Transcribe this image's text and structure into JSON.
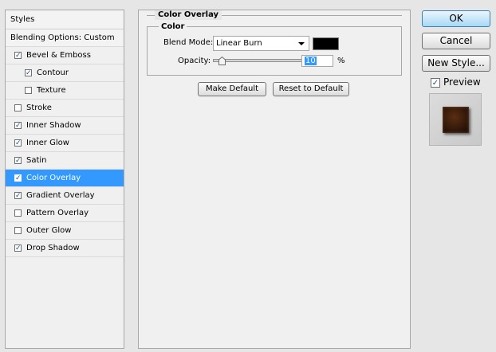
{
  "styles_panel": {
    "header": "Styles",
    "blending_options": "Blending Options: Custom",
    "items": [
      {
        "label": "Bevel & Emboss",
        "checked": true,
        "indent": false
      },
      {
        "label": "Contour",
        "checked": true,
        "indent": true
      },
      {
        "label": "Texture",
        "checked": false,
        "indent": true
      },
      {
        "label": "Stroke",
        "checked": false,
        "indent": false
      },
      {
        "label": "Inner Shadow",
        "checked": true,
        "indent": false
      },
      {
        "label": "Inner Glow",
        "checked": true,
        "indent": false
      },
      {
        "label": "Satin",
        "checked": true,
        "indent": false
      },
      {
        "label": "Color Overlay",
        "checked": true,
        "indent": false,
        "selected": true
      },
      {
        "label": "Gradient Overlay",
        "checked": true,
        "indent": false
      },
      {
        "label": "Pattern Overlay",
        "checked": false,
        "indent": false
      },
      {
        "label": "Outer Glow",
        "checked": false,
        "indent": false
      },
      {
        "label": "Drop Shadow",
        "checked": true,
        "indent": false
      }
    ]
  },
  "color_overlay": {
    "title": "Color Overlay",
    "group_title": "Color",
    "blend_mode_label": "Blend Mode:",
    "blend_mode_value": "Linear Burn",
    "overlay_color": "#000000",
    "opacity_label": "Opacity:",
    "opacity_value": "10",
    "opacity_unit": "%",
    "opacity_fraction": 0.1,
    "make_default_label": "Make Default",
    "reset_default_label": "Reset to Default"
  },
  "actions": {
    "ok_label": "OK",
    "cancel_label": "Cancel",
    "new_style_label": "New Style...",
    "preview_label": "Preview",
    "preview_checked": true
  },
  "colors": {
    "selection": "#3399ff",
    "panel_bg": "#f0f0f0",
    "dialog_bg": "#e6e6e6"
  }
}
